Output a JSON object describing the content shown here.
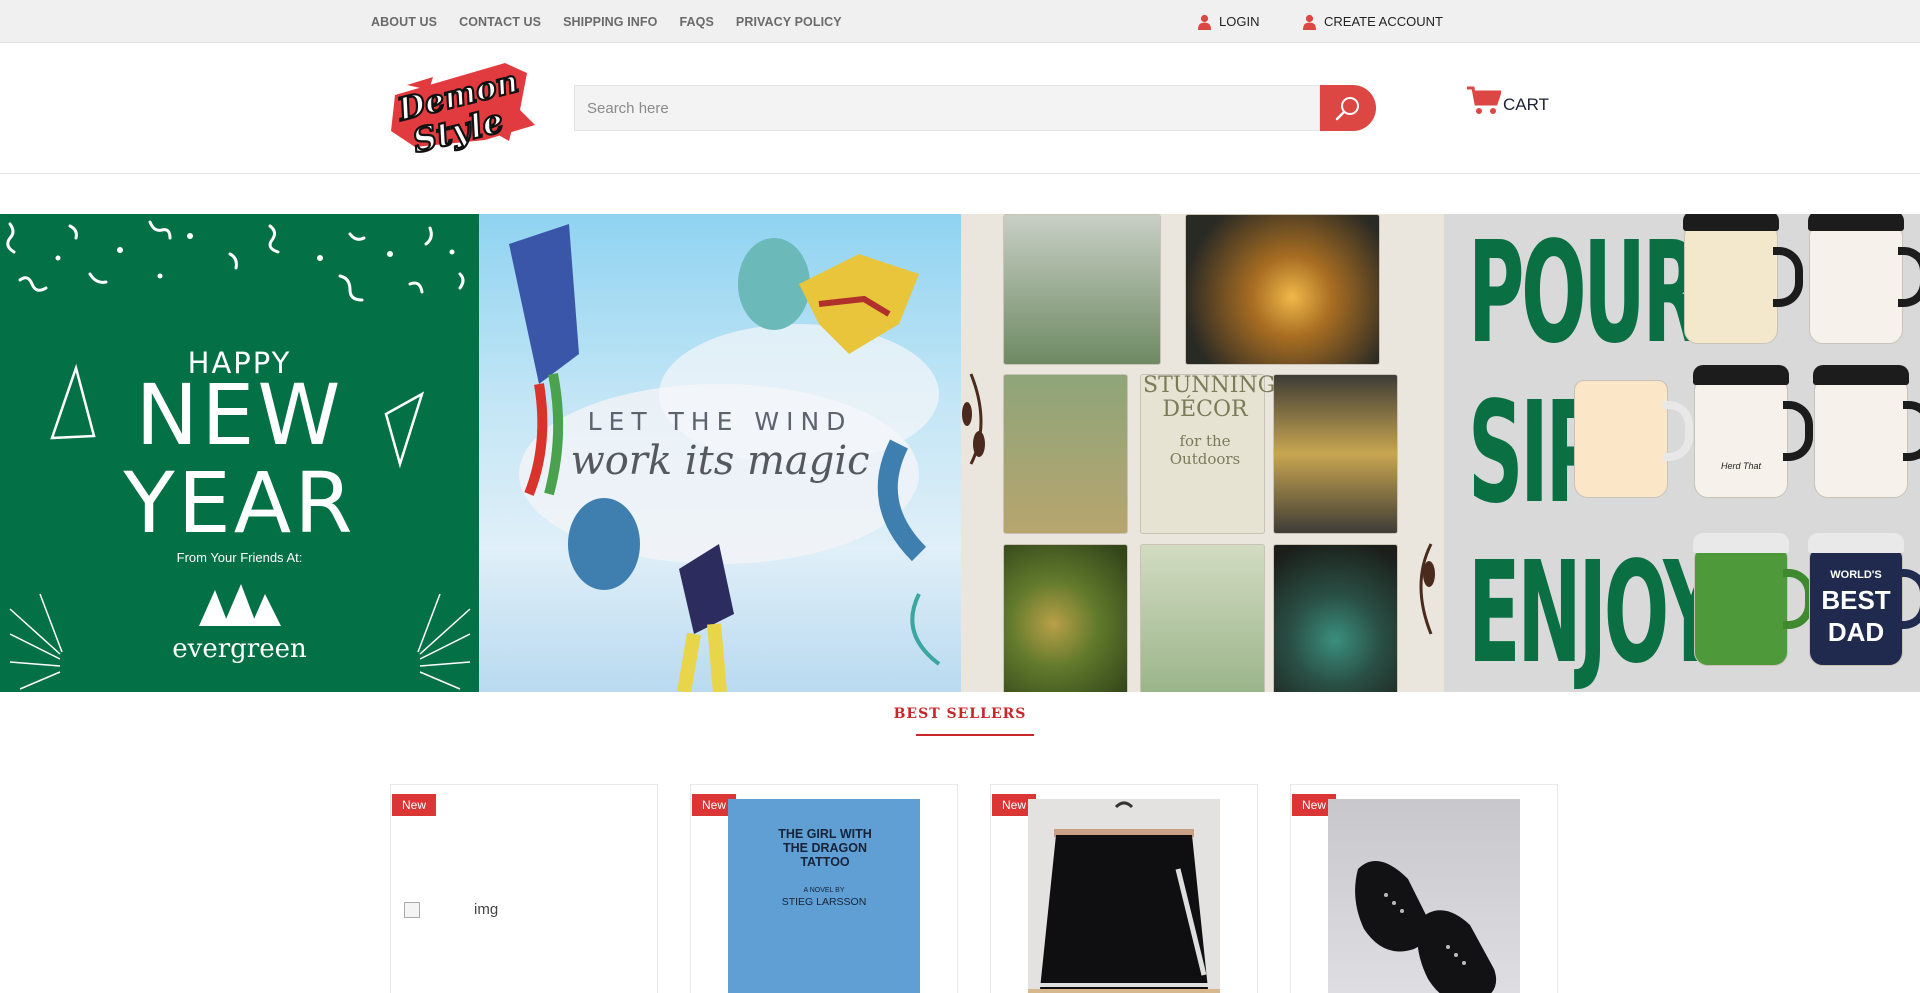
{
  "topbar": {
    "links": [
      "ABOUT US",
      "CONTACT US",
      "SHIPPING INFO",
      "FAQS",
      "PRIVACY POLICY"
    ],
    "login": "LOGIN",
    "create_account": "CREATE ACCOUNT"
  },
  "header": {
    "logo_text": "Demon Style",
    "search_placeholder": "Search here",
    "cart_label": "CART"
  },
  "banner": {
    "new_year": {
      "happy": "HAPPY",
      "new": "NEW",
      "year": "YEAR",
      "from": "From Your Friends At:",
      "brand": "evergreen"
    },
    "wind": {
      "line1": "LET THE WIND",
      "line2": "work its magic"
    },
    "decor": {
      "title": "STUNNING DÉCOR",
      "subtitle": "for the Outdoors"
    },
    "mugs": {
      "words": [
        "POUR",
        "SIP",
        "ENJOY"
      ],
      "mug_text": [
        "WORLD'S",
        "BEST",
        "DAD"
      ],
      "mug_small": "Herd That"
    }
  },
  "best_sellers": {
    "title": "BEST SELLERS",
    "products": [
      {
        "badge": "New",
        "image_alt": "img"
      },
      {
        "badge": "New",
        "book_title": "THE GIRL WITH THE DRAGON TATTOO",
        "book_subtitle": "A NOVEL BY",
        "book_author": "STIEG LARSSON"
      },
      {
        "badge": "New"
      },
      {
        "badge": "New"
      }
    ]
  },
  "colors": {
    "accent_red": "#dc4743",
    "badge_red": "#dc3535",
    "section_red": "#c8272a",
    "evergreen": "#047046",
    "pour_green": "#0a7044"
  }
}
